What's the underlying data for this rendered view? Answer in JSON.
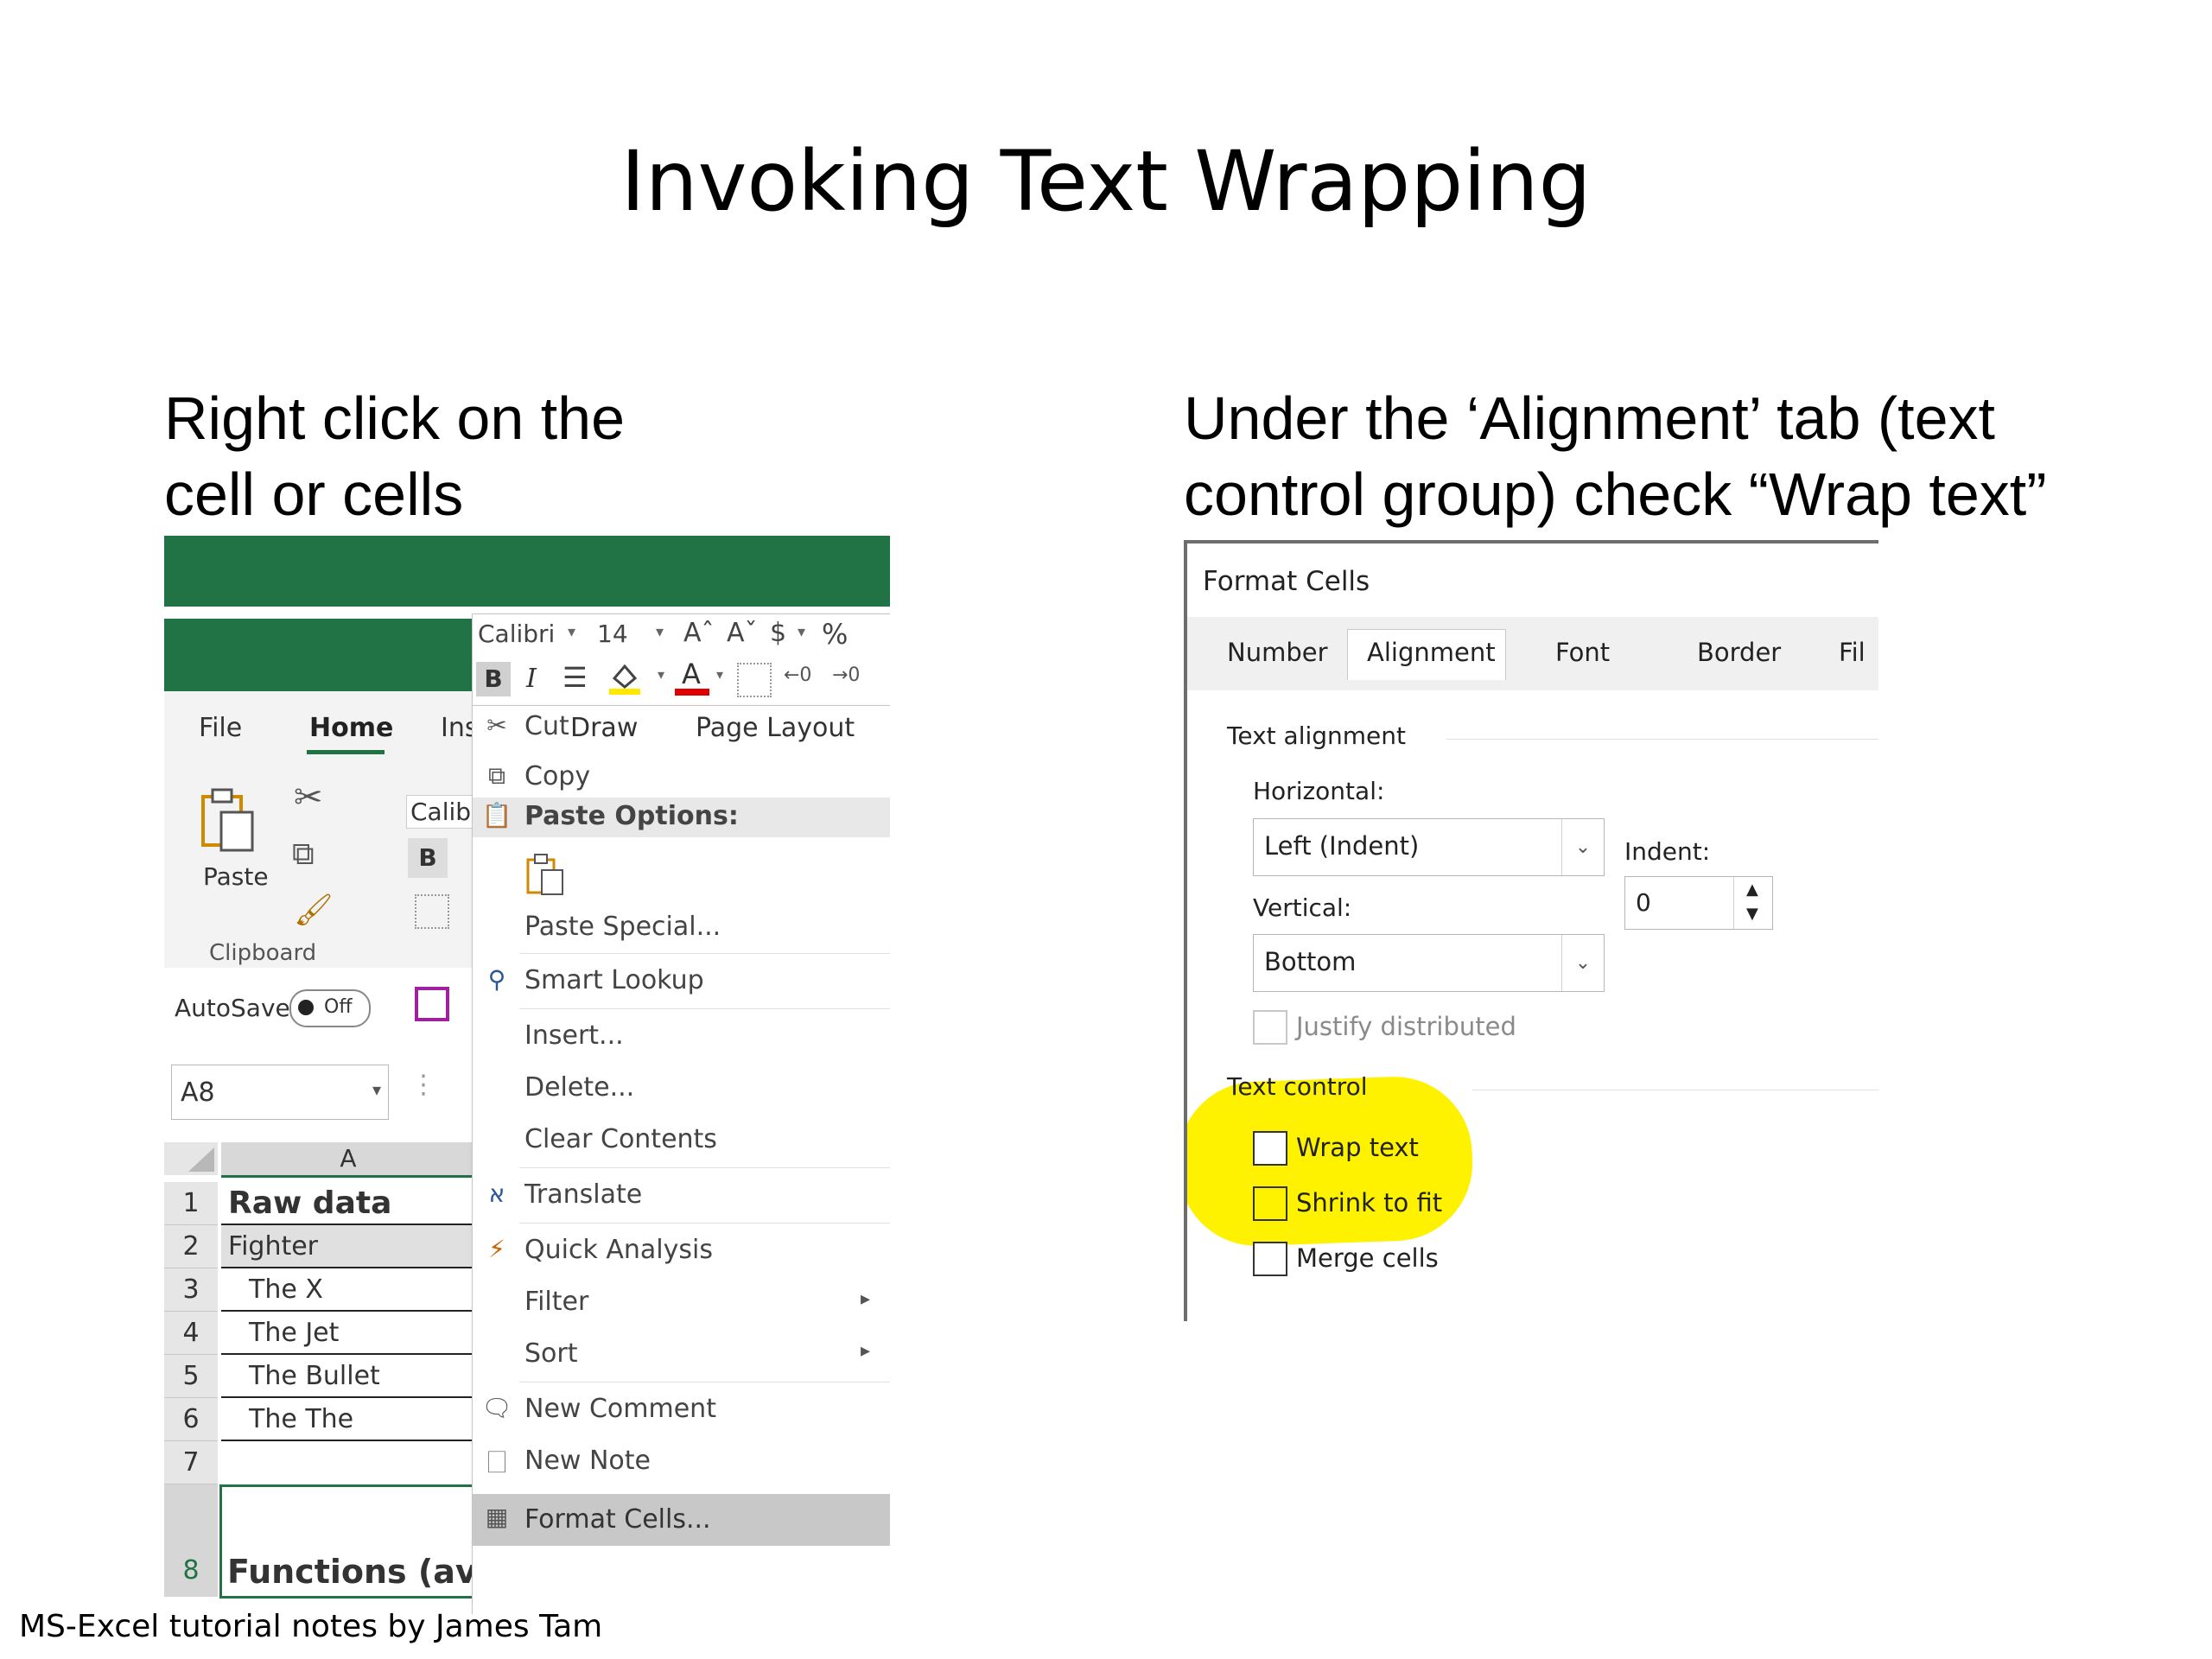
{
  "slide": {
    "title": "Invoking Text Wrapping",
    "left_heading_line1": "Right click on the",
    "left_heading_line2": "cell or cells",
    "right_heading_line1": "Under the ‘Alignment’ tab (text",
    "right_heading_line2": "control group) check “Wrap text”",
    "footer": "MS-Excel tutorial notes by James Tam"
  },
  "excel": {
    "mini_toolbar": {
      "font": "Calibri",
      "size": "14",
      "bold": "B",
      "italic": "I",
      "grow": "Aˆ",
      "shrink": "Aˇ",
      "currency": "$",
      "percent": "%"
    },
    "tabs": [
      "File",
      "Home",
      "Insert",
      "Draw",
      "Page Layout"
    ],
    "ribbon": {
      "paste": "Paste",
      "clipboard": "Clipboard",
      "font_partial": "Calib",
      "bold": "B",
      "autosave": "AutoSave",
      "autosave_state": "Off"
    },
    "name_box": "A8",
    "column_header": "A",
    "rows": [
      {
        "num": "1",
        "value": "Raw data"
      },
      {
        "num": "2",
        "value": "Fighter"
      },
      {
        "num": "3",
        "value": "The X"
      },
      {
        "num": "4",
        "value": "The Jet"
      },
      {
        "num": "5",
        "value": "The Bullet"
      },
      {
        "num": "6",
        "value": "The The"
      },
      {
        "num": "7",
        "value": ""
      },
      {
        "num": "8",
        "value": "Functions (ave"
      }
    ],
    "context_menu": {
      "cut": "Cut",
      "copy": "Copy",
      "paste_options": "Paste Options:",
      "paste_special": "Paste Special...",
      "smart_lookup": "Smart Lookup",
      "insert": "Insert...",
      "delete": "Delete...",
      "clear_contents": "Clear Contents",
      "translate": "Translate",
      "quick_analysis": "Quick Analysis",
      "filter": "Filter",
      "sort": "Sort",
      "new_comment": "New Comment",
      "new_note": "New Note",
      "format_cells": "Format Cells..."
    }
  },
  "format_cells": {
    "title": "Format Cells",
    "tabs": [
      "Number",
      "Alignment",
      "Font",
      "Border",
      "Fil"
    ],
    "text_alignment": "Text alignment",
    "horizontal_label": "Horizontal:",
    "horizontal_value": "Left (Indent)",
    "vertical_label": "Vertical:",
    "vertical_value": "Bottom",
    "indent_label": "Indent:",
    "indent_value": "0",
    "justify_distributed": "Justify distributed",
    "text_control": "Text control",
    "wrap_text": "Wrap text",
    "shrink_to_fit": "Shrink to fit",
    "merge_cells": "Merge cells",
    "highlight_color": "#fff200"
  }
}
